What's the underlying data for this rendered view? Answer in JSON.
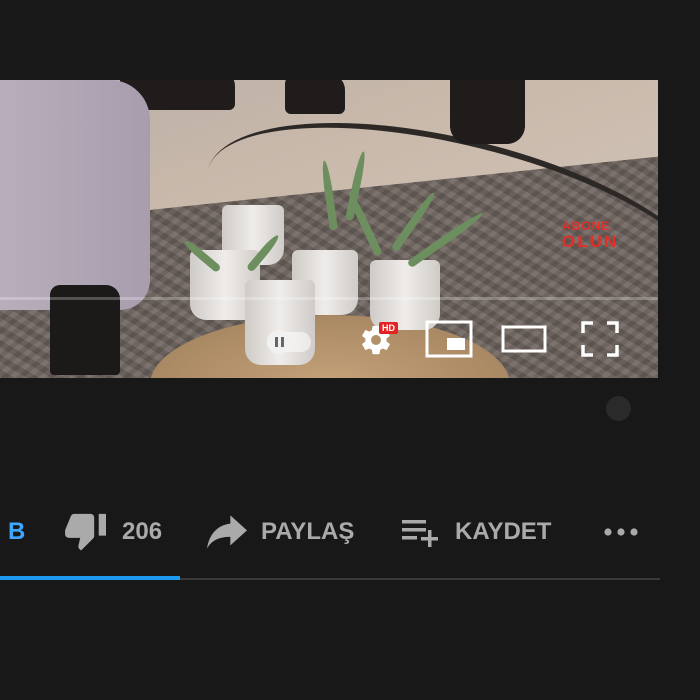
{
  "video": {
    "overlay_text_line1": "ABONE",
    "overlay_text_line2": "OLUN",
    "settings_badge": "HD"
  },
  "actions": {
    "like_label_fragment": "B",
    "dislike_count": "206",
    "share_label": "PAYLAŞ",
    "save_label": "KAYDET"
  },
  "icons": {
    "dislike": "thumbs-down-icon",
    "share": "share-arrow-icon",
    "save": "playlist-add-icon",
    "more": "more-horiz-icon",
    "autoplay": "autoplay-toggle-icon",
    "settings": "gear-icon",
    "miniplayer": "miniplayer-icon",
    "theater": "theater-mode-icon",
    "fullscreen": "fullscreen-icon"
  },
  "colors": {
    "background": "#181818",
    "accent": "#3ea6ff",
    "hd_badge": "#e32323",
    "overlay_text": "#e52d27"
  }
}
